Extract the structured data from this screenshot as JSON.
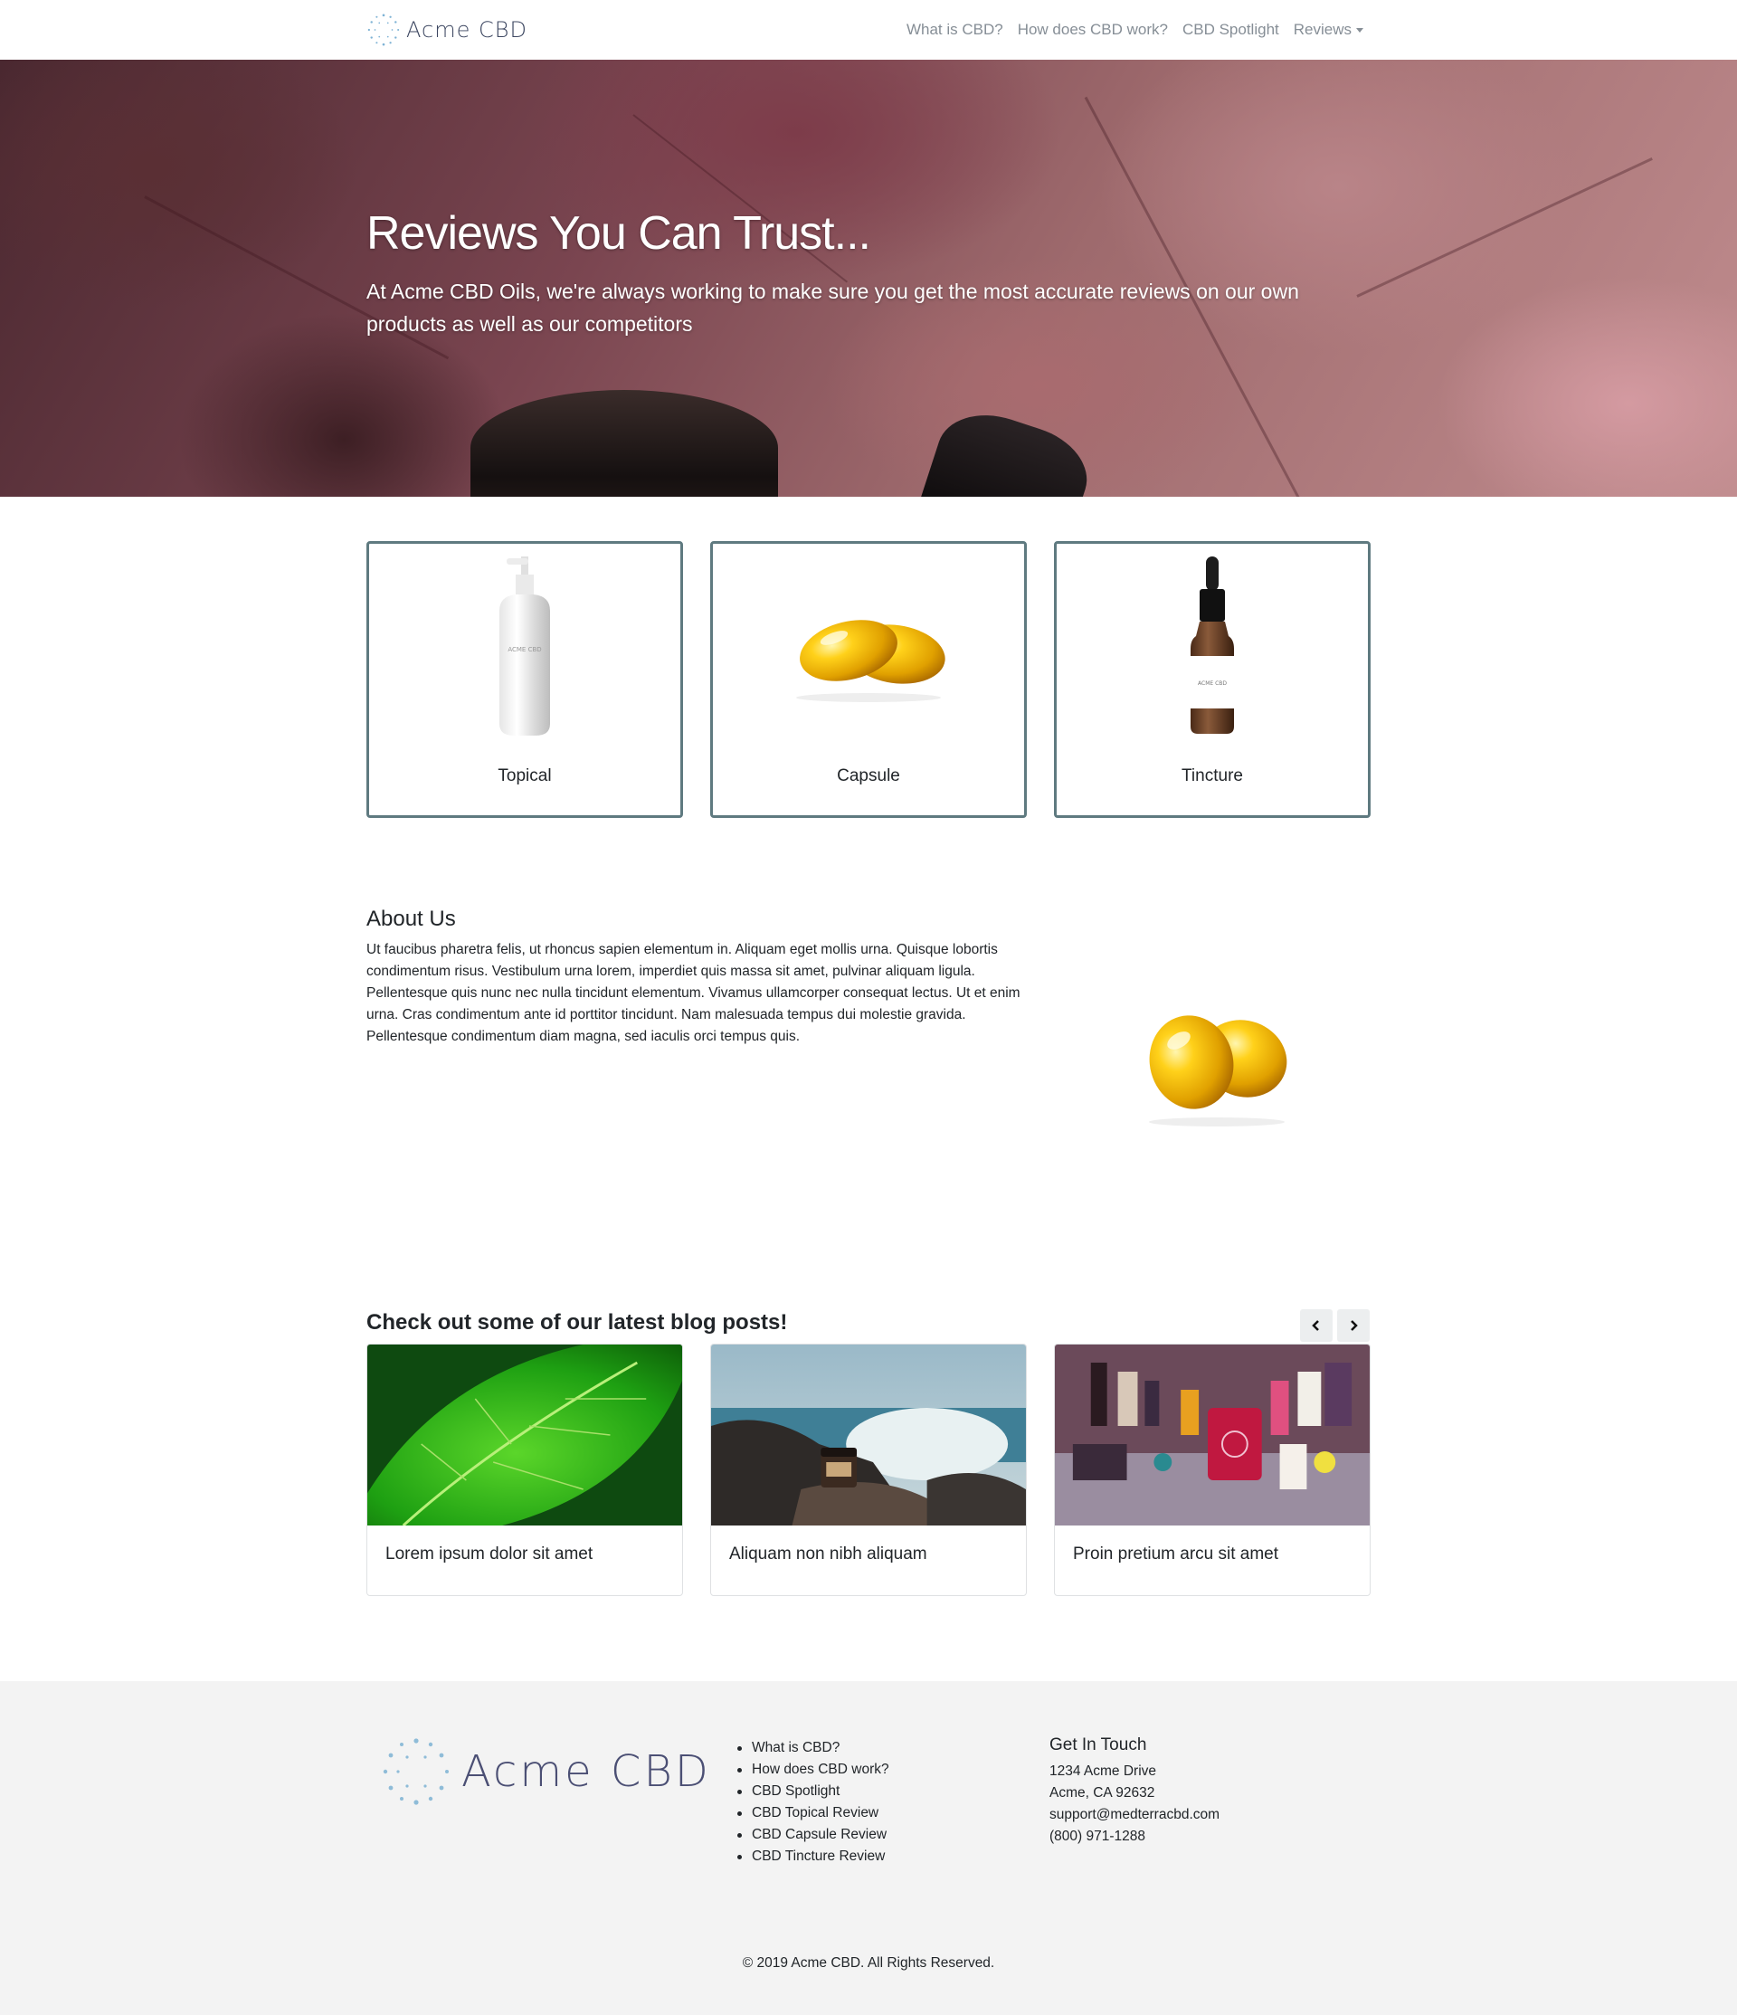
{
  "nav": {
    "brand": "Acme CBD",
    "links": [
      "What is CBD?",
      "How does CBD work?",
      "CBD Spotlight",
      "Reviews"
    ]
  },
  "hero": {
    "title": "Reviews You Can Trust...",
    "subtitle": "At Acme CBD Oils, we're always working to make sure you get the most accurate reviews on our own products as well as our competitors"
  },
  "categories": [
    {
      "label": "Topical"
    },
    {
      "label": "Capsule"
    },
    {
      "label": "Tincture"
    }
  ],
  "about": {
    "title": "About Us",
    "text": "Ut faucibus pharetra felis, ut rhoncus sapien elementum in. Aliquam eget mollis urna. Quisque lobortis condimentum risus. Vestibulum urna lorem, imperdiet quis massa sit amet, pulvinar aliquam ligula. Pellentesque quis nunc nec nulla tincidunt elementum. Vivamus ullamcorper consequat lectus. Ut et enim urna. Cras condimentum ante id porttitor tincidunt. Nam malesuada tempus dui molestie gravida. Pellentesque condimentum diam magna, sed iaculis orci tempus quis."
  },
  "blog": {
    "title": "Check out some of our latest blog posts!",
    "posts": [
      {
        "label": "Lorem ipsum dolor sit amet"
      },
      {
        "label": "Aliquam non nibh aliquam"
      },
      {
        "label": "Proin pretium arcu sit amet"
      }
    ]
  },
  "footer": {
    "logo_text": "Acme CBD",
    "links": [
      "What is CBD?",
      "How does CBD work?",
      "CBD Spotlight",
      "CBD Topical Review",
      "CBD Capsule Review",
      "CBD Tincture Review"
    ],
    "contact": {
      "title": "Get In Touch",
      "address1": "1234 Acme Drive",
      "address2": "Acme, CA 92632",
      "email": "support@medterracbd.com",
      "phone": "(800) 971-1288"
    },
    "copyright": "© 2019 Acme CBD. All Rights Reserved."
  },
  "colors": {
    "card_border": "#5f7a80",
    "footer_bg": "#f3f3f3",
    "nav_link": "#868e96"
  },
  "icons": {
    "brand_logo": "dotted-circle-logo-icon",
    "prev_arrow": "chevron-left-icon",
    "next_arrow": "chevron-right-icon",
    "dropdown_caret": "caret-down-icon"
  }
}
